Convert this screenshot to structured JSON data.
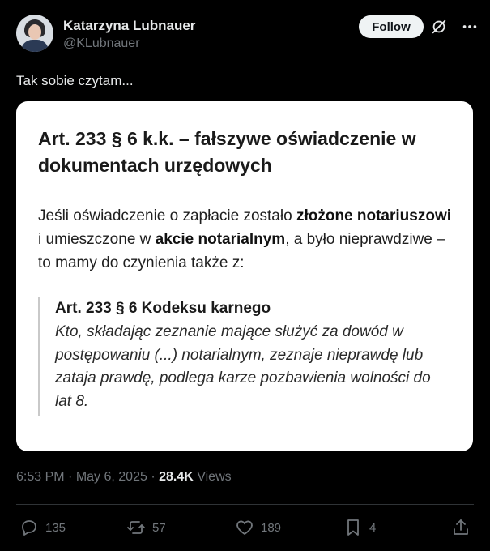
{
  "author": {
    "name": "Katarzyna Lubnauer",
    "handle": "@KLubnauer",
    "follow_label": "Follow"
  },
  "tweet": {
    "text": "Tak sobie czytam..."
  },
  "card": {
    "title": "Art. 233 § 6 k.k. – fałszywe oświadczenie w dokumentach urzędowych",
    "paragraph": [
      {
        "text": "Jeśli oświadczenie o zapłacie zostało ",
        "bold": false
      },
      {
        "text": "złożone notariuszowi",
        "bold": true
      },
      {
        "text": " i umieszczone w ",
        "bold": false
      },
      {
        "text": "akcie notarialnym",
        "bold": true
      },
      {
        "text": ", a było nieprawdziwe – to mamy do czynienia także z:",
        "bold": false
      }
    ],
    "quote_title": "Art. 233 § 6 Kodeksu karnego",
    "quote_body": "Kto, składając zeznanie mające służyć za dowód w postępowaniu (...) notarialnym, zeznaje nieprawdę lub zataja prawdę, podlega karze pozbawienia wolności do lat 8."
  },
  "meta": {
    "time": "6:53 PM",
    "date": "May 6, 2025",
    "separator": " · ",
    "views_count": "28.4K",
    "views_label": " Views"
  },
  "actions": {
    "replies": "135",
    "reposts": "57",
    "likes": "189",
    "bookmarks": "4"
  },
  "icons": {
    "grok": "grok-icon",
    "more": "more-icon",
    "reply": "reply-icon",
    "repost": "repost-icon",
    "like": "heart-icon",
    "bookmark": "bookmark-icon",
    "share": "share-icon"
  }
}
